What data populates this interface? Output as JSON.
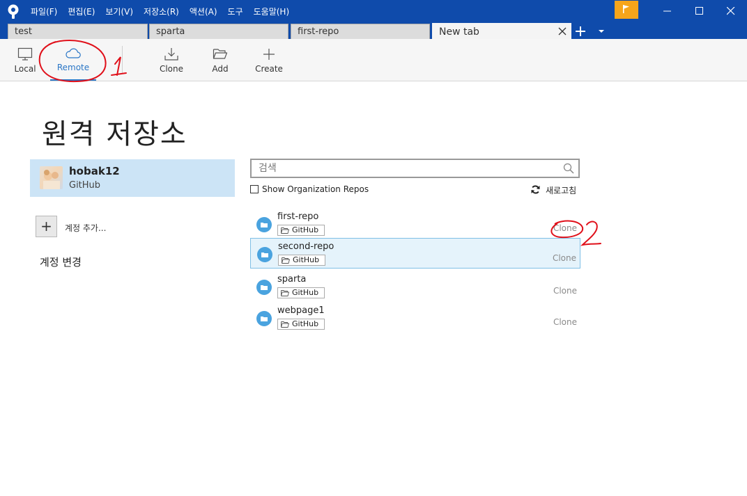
{
  "menu": [
    "파일(F)",
    "편집(E)",
    "보기(V)",
    "저장소(R)",
    "액션(A)",
    "도구",
    "도움말(H)"
  ],
  "tabs": [
    "test",
    "sparta",
    "first-repo",
    "New tab"
  ],
  "toolbar": {
    "local": "Local",
    "remote": "Remote",
    "clone": "Clone",
    "add": "Add",
    "create": "Create"
  },
  "page_title": "원격 저장소",
  "account": {
    "name": "hobak12",
    "service": "GitHub"
  },
  "add_account_label": "계정 추가...",
  "change_account_label": "계정 변경",
  "search": {
    "placeholder": "검색",
    "value": ""
  },
  "org_repos_label": "Show Organization Repos",
  "refresh_label": "새로고침",
  "repos": [
    {
      "name": "first-repo",
      "badge": "GitHub",
      "action": "Clone"
    },
    {
      "name": "second-repo",
      "badge": "GitHub",
      "action": "Clone",
      "selected": true
    },
    {
      "name": "sparta",
      "badge": "GitHub",
      "action": "Clone"
    },
    {
      "name": "webpage1",
      "badge": "GitHub",
      "action": "Clone"
    }
  ],
  "annotations": [
    "1",
    "2"
  ],
  "colors": {
    "titlebar": "#0f4bab",
    "accent": "#2a76c6",
    "flag": "#f6a51b",
    "selection": "#cce4f6",
    "annotation": "#e0101a"
  }
}
